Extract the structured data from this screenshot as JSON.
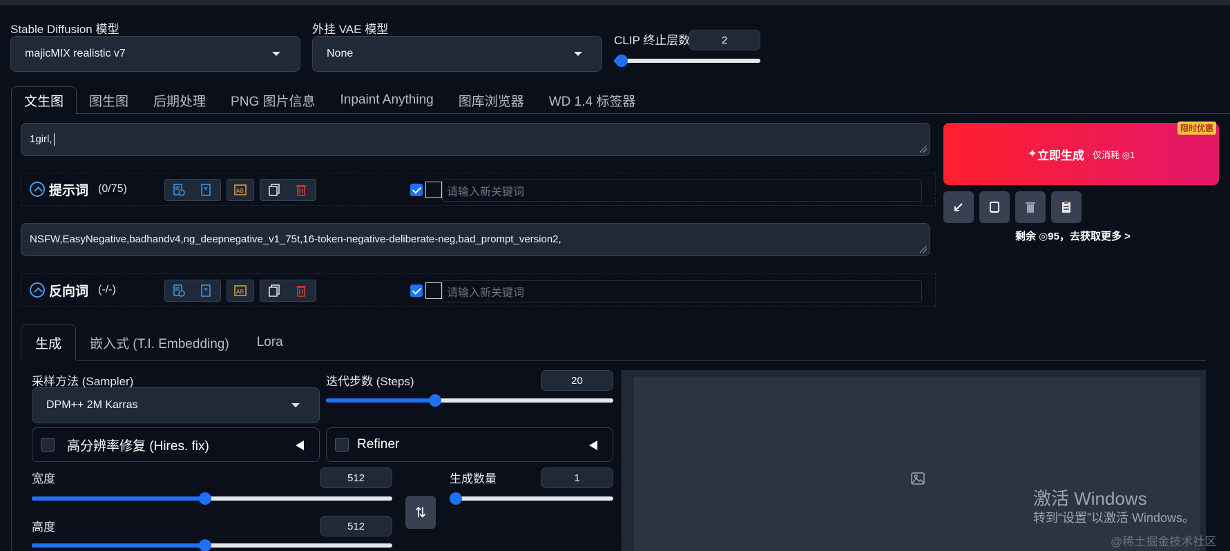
{
  "models": {
    "sd_label": "Stable Diffusion 模型",
    "sd_value": "majicMIX realistic v7",
    "vae_label": "外挂 VAE 模型",
    "vae_value": "None",
    "clip_label": "CLIP 终止层数",
    "clip_value": "2"
  },
  "tabs": [
    "文生图",
    "图生图",
    "后期处理",
    "PNG 图片信息",
    "Inpaint Anything",
    "图库浏览器",
    "WD 1.4 标签器"
  ],
  "prompt": {
    "text": "1girl,",
    "title": "提示词",
    "count": "(0/75)",
    "keyword_placeholder": "请输入新关键词"
  },
  "negative": {
    "text": "NSFW,EasyNegative,badhandv4,ng_deepnegative_v1_75t,16-token-negative-deliberate-neg,bad_prompt_version2,",
    "title": "反向词",
    "count": "(-/-)",
    "keyword_placeholder": "请输入新关键词"
  },
  "generate": {
    "label": "立即生成",
    "cost": "· 仅消耗 ◎1",
    "promo": "限时优惠",
    "remaining": "剩余 ◎95，去获取更多 >"
  },
  "subtabs": [
    "生成",
    "嵌入式 (T.I. Embedding)",
    "Lora"
  ],
  "settings": {
    "sampler_label": "采样方法 (Sampler)",
    "sampler_value": "DPM++ 2M Karras",
    "steps_label": "迭代步数 (Steps)",
    "steps_value": "20",
    "steps_fraction": 0.38,
    "hires_label": "高分辨率修复 (Hires. fix)",
    "refiner_label": "Refiner",
    "width_label": "宽度",
    "width_value": "512",
    "width_fraction": 0.48,
    "height_label": "高度",
    "height_value": "512",
    "height_fraction": 0.48,
    "batch_label": "生成数量",
    "batch_value": "1",
    "batch_fraction": 0.0,
    "clip_fraction": 0.05
  },
  "watermark": {
    "line1": "激活 Windows",
    "line2": "转到“设置”以激活 Windows。",
    "site": "@稀土掘金技术社区"
  },
  "colors": {
    "accent": "#1d72f3",
    "generate_start": "#ff1f2d",
    "generate_end": "#e3176a"
  }
}
